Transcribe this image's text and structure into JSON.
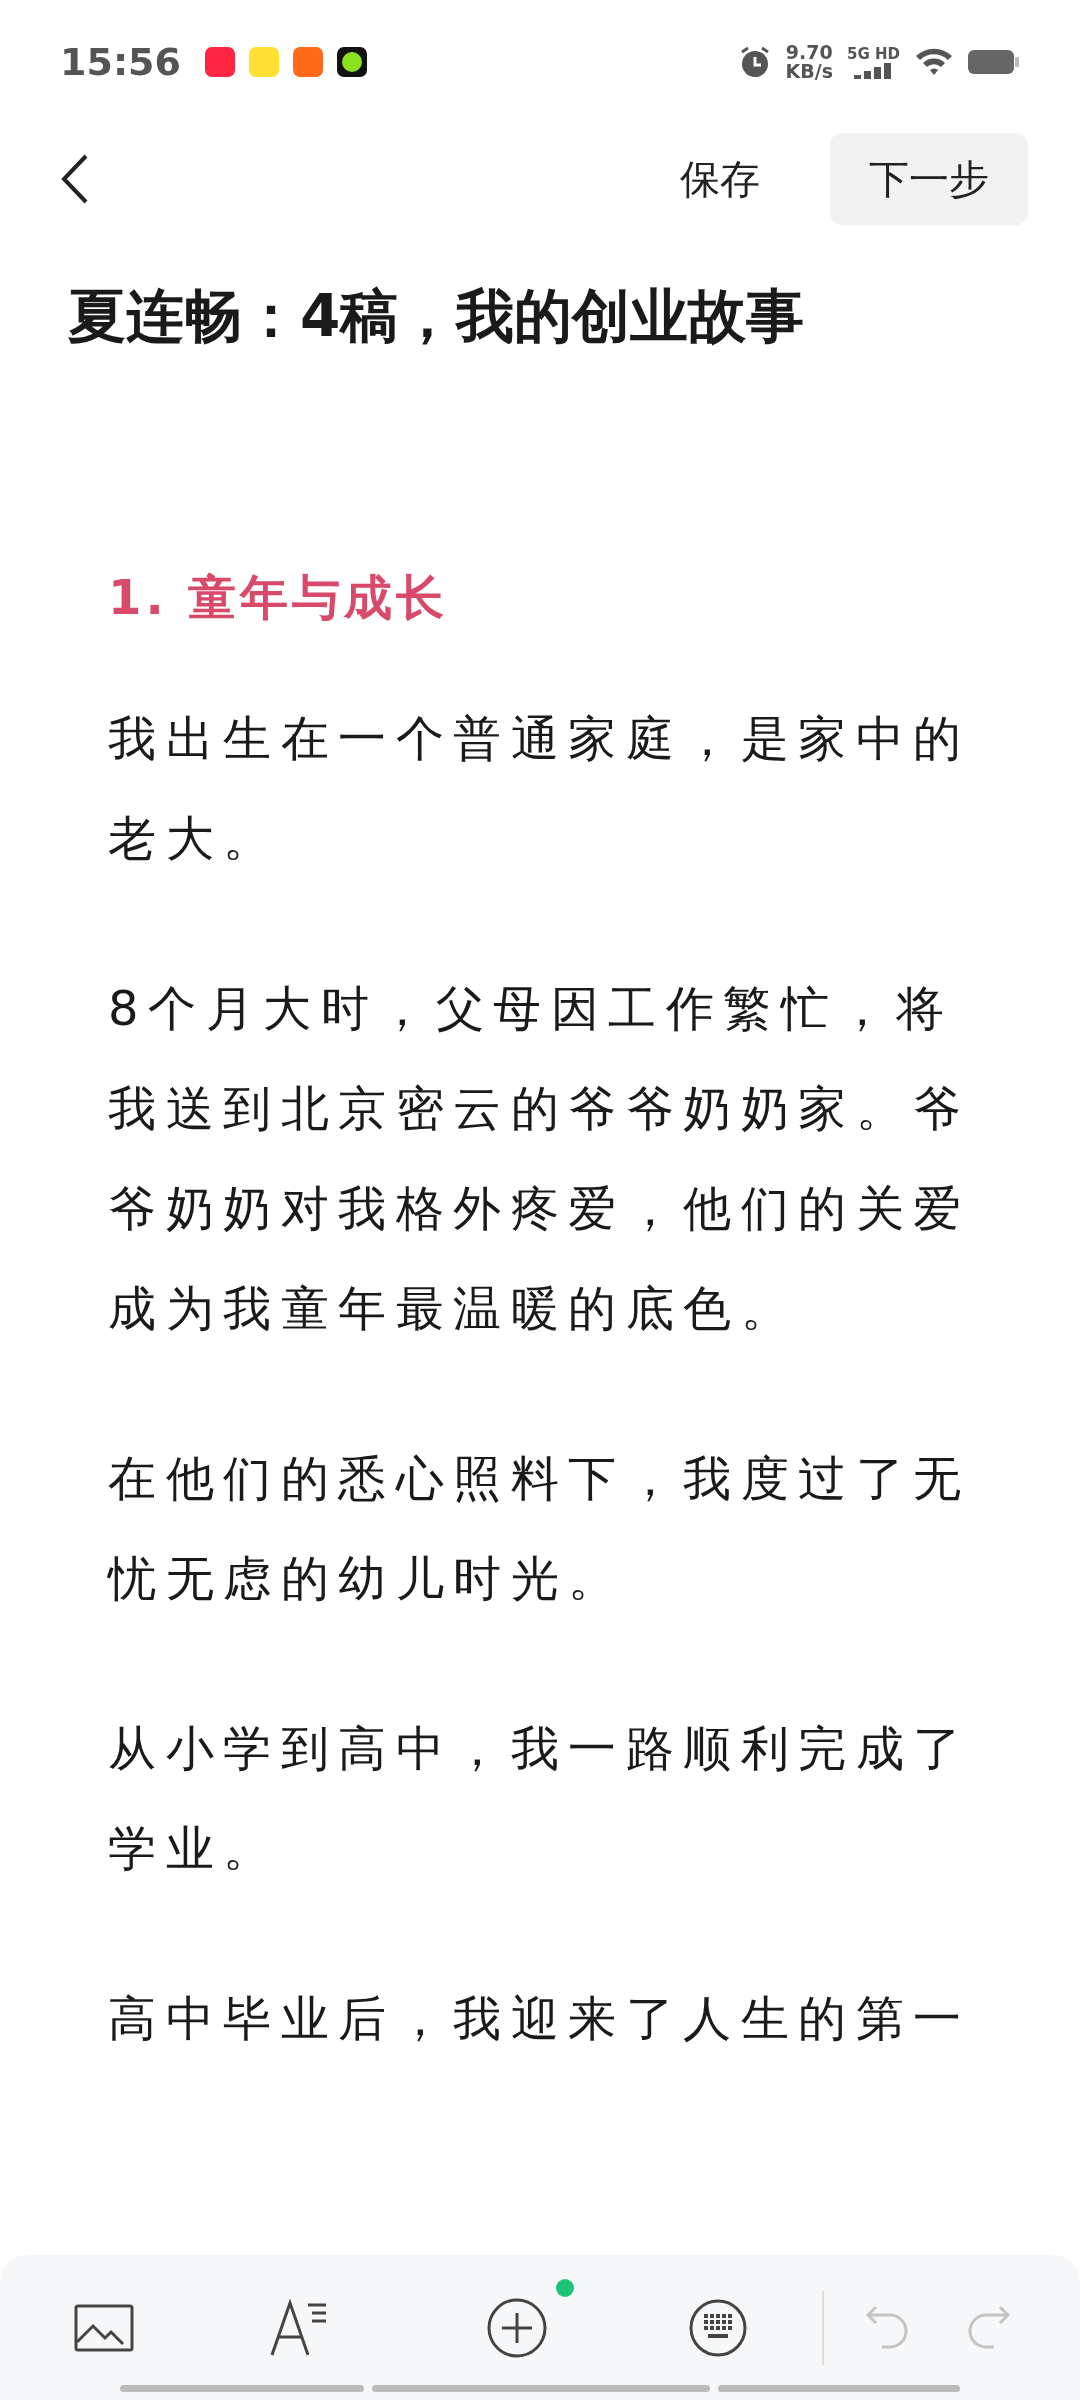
{
  "status_bar": {
    "time": "15:56",
    "net_speed": "9.70",
    "net_unit": "KB/s",
    "network": "5G HD"
  },
  "nav": {
    "save": "保存",
    "next": "下一步"
  },
  "title": "夏连畅：4稿，我的创业故事",
  "section": "1. 童年与成长",
  "paragraphs": [
    "我出生在一个普通家庭，是家中的老大。",
    "8个月大时，父母因工作繁忙，将我送到北京密云的爷爷奶奶家。爷爷奶奶对我格外疼爱，他们的关爱成为我童年最温暖的底色。",
    "在他们的悉心照料下，我度过了无忧无虑的幼儿时光。",
    "从小学到高中，我一路顺利完成了学业。",
    "高中毕业后，我迎来了人生的第一"
  ],
  "toolbar": {
    "new_dot": true
  }
}
